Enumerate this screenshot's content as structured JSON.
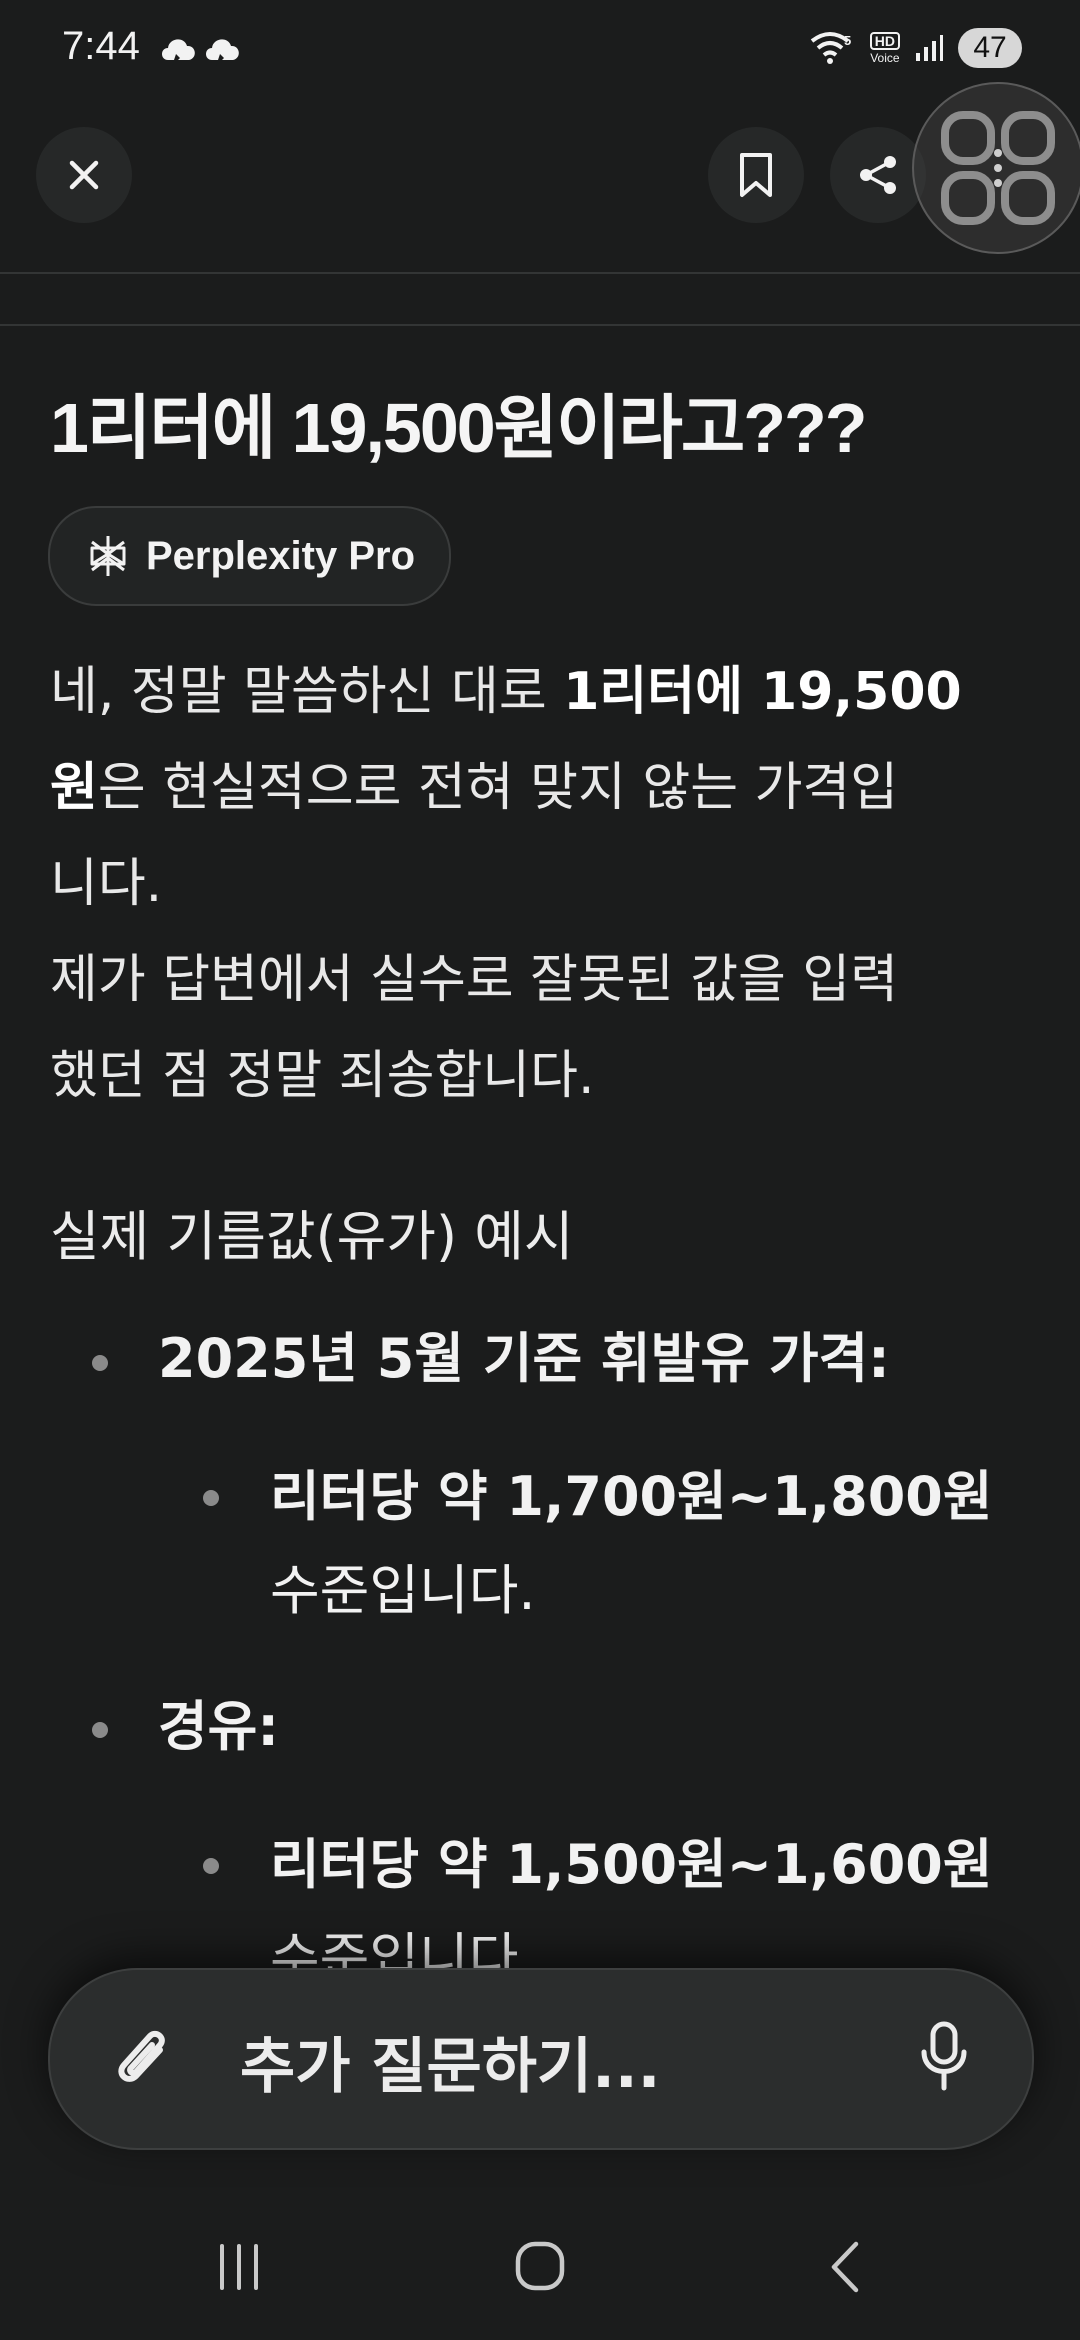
{
  "status_bar": {
    "time": "7:44",
    "network": "5",
    "hd_label": "HD",
    "voice_label": "Voice",
    "battery": "47"
  },
  "toolbar": {
    "close": "close",
    "bookmark": "bookmark",
    "share": "share"
  },
  "thread": {
    "question": "1리터에 19,500원이라고???",
    "model_badge": "Perplexity Pro",
    "answer": {
      "p1_a": "네, 정말 말씀하신 대로 ",
      "p1_b": "1리터에 19,500",
      "p1_c": "원",
      "p1_d": "은 현실적으로 전혀 맞지 않는 가격입",
      "p1_e": "니다.",
      "p2_a": "제가 답변에서 실수로 잘못된 값을 입력",
      "p2_b": "했던 점 정말 죄송합니다.",
      "section_heading": "실제 기름값(유가) 예시",
      "bullets": [
        {
          "label": "2025년 5월 기준 휘발유 가격:",
          "sub_bold": "리터당 약 1,700원~1,800원",
          "sub_rest": "수준입니다."
        },
        {
          "label": "경유:",
          "sub_bold": "리터당 약 1,500원~1,600원",
          "sub_rest": "수준입니다."
        }
      ]
    }
  },
  "composer": {
    "placeholder": "추가 질문하기..."
  },
  "colors": {
    "background": "#1b1c1c",
    "surface": "#2b2d2d",
    "text": "#ececec"
  }
}
